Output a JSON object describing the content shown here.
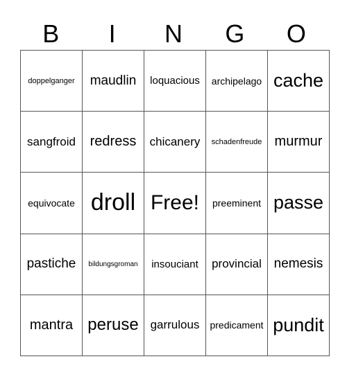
{
  "header": {
    "letters": [
      "B",
      "I",
      "N",
      "G",
      "O"
    ]
  },
  "card": {
    "rows": [
      [
        "doppelganger",
        "maudlin",
        "loquacious",
        "archipelago",
        "cache"
      ],
      [
        "sangfroid",
        "redress",
        "chicanery",
        "schadenfreude",
        "murmur"
      ],
      [
        "equivocate",
        "droll",
        "Free!",
        "preeminent",
        "passe"
      ],
      [
        "pastiche",
        "bildungsgroman",
        "insouciant",
        "provincial",
        "nemesis"
      ],
      [
        "mantra",
        "peruse",
        "garrulous",
        "predicament",
        "pundit"
      ]
    ]
  }
}
